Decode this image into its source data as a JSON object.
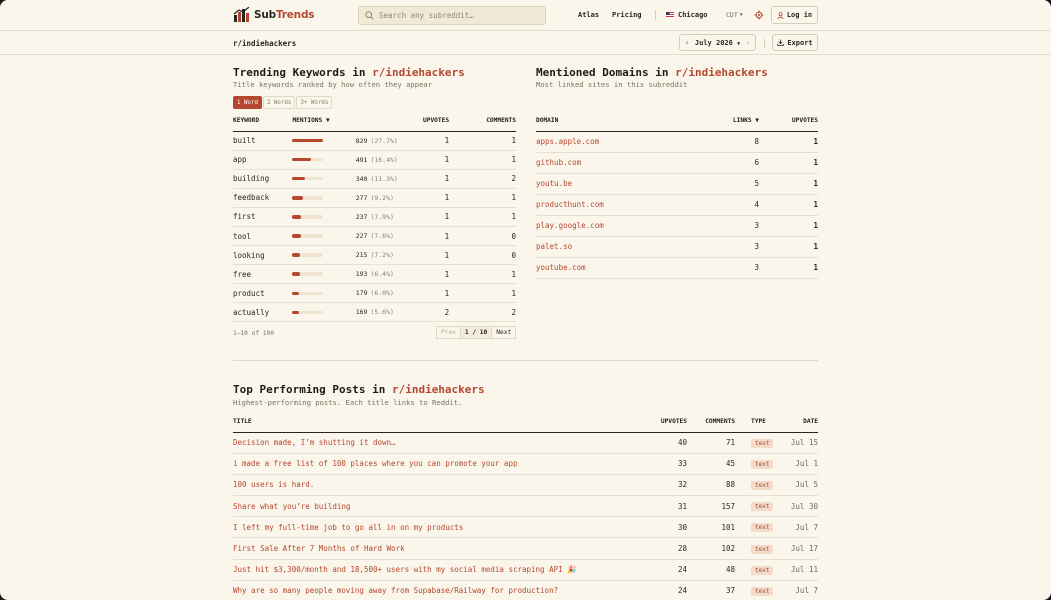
{
  "brand": {
    "part1": "Sub",
    "part2": "Trends"
  },
  "search": {
    "placeholder": "Search any subreddit…"
  },
  "nav": {
    "atlas": "Atlas",
    "pricing": "Pricing",
    "city": "Chicago",
    "tz": "CDT",
    "login": "Log in"
  },
  "subbar": {
    "subreddit": "r/indiehackers",
    "month": "July 2026",
    "export": "Export"
  },
  "keywords": {
    "title_prefix": "Trending Keywords in ",
    "subreddit": "r/indiehackers",
    "description": "Title keywords ranked by how often they appear",
    "tabs": [
      "1 Word",
      "2 Words",
      "3+ Words"
    ],
    "columns": {
      "keyword": "KEYWORD",
      "mentions": "MENTIONS ▼",
      "upvotes": "UPVOTES",
      "comments": "COMMENTS"
    },
    "rows": [
      {
        "keyword": "built",
        "mentions": "829",
        "pct": "(27.7%)",
        "share": 0.277,
        "upvotes": "1",
        "comments": "1"
      },
      {
        "keyword": "app",
        "mentions": "491",
        "pct": "(16.4%)",
        "share": 0.164,
        "upvotes": "1",
        "comments": "1"
      },
      {
        "keyword": "building",
        "mentions": "340",
        "pct": "(11.3%)",
        "share": 0.113,
        "upvotes": "1",
        "comments": "2"
      },
      {
        "keyword": "feedback",
        "mentions": "277",
        "pct": "(9.2%)",
        "share": 0.092,
        "upvotes": "1",
        "comments": "1"
      },
      {
        "keyword": "first",
        "mentions": "237",
        "pct": "(7.9%)",
        "share": 0.079,
        "upvotes": "1",
        "comments": "1"
      },
      {
        "keyword": "tool",
        "mentions": "227",
        "pct": "(7.6%)",
        "share": 0.076,
        "upvotes": "1",
        "comments": "0"
      },
      {
        "keyword": "looking",
        "mentions": "215",
        "pct": "(7.2%)",
        "share": 0.072,
        "upvotes": "1",
        "comments": "0"
      },
      {
        "keyword": "free",
        "mentions": "193",
        "pct": "(6.4%)",
        "share": 0.064,
        "upvotes": "1",
        "comments": "1"
      },
      {
        "keyword": "product",
        "mentions": "179",
        "pct": "(6.0%)",
        "share": 0.06,
        "upvotes": "1",
        "comments": "1"
      },
      {
        "keyword": "actually",
        "mentions": "169",
        "pct": "(5.6%)",
        "share": 0.056,
        "upvotes": "2",
        "comments": "2"
      }
    ],
    "pager": {
      "info": "1–10 of 100",
      "prev": "Prev",
      "page": "1 / 10",
      "next": "Next"
    }
  },
  "domains": {
    "title_prefix": "Mentioned Domains in ",
    "subreddit": "r/indiehackers",
    "description": "Most linked sites in this subreddit",
    "columns": {
      "domain": "DOMAIN",
      "links": "LINKS ▼",
      "upvotes": "UPVOTES"
    },
    "rows": [
      {
        "domain": "apps.apple.com",
        "links": "8",
        "upvotes": "1"
      },
      {
        "domain": "github.com",
        "links": "6",
        "upvotes": "1"
      },
      {
        "domain": "youtu.be",
        "links": "5",
        "upvotes": "1"
      },
      {
        "domain": "producthunt.com",
        "links": "4",
        "upvotes": "1"
      },
      {
        "domain": "play.google.com",
        "links": "3",
        "upvotes": "1"
      },
      {
        "domain": "palet.so",
        "links": "3",
        "upvotes": "1"
      },
      {
        "domain": "youtube.com",
        "links": "3",
        "upvotes": "1"
      }
    ]
  },
  "posts": {
    "title_prefix": "Top Performing Posts in ",
    "subreddit": "r/indiehackers",
    "description": "Highest-performing posts. Each title links to Reddit.",
    "columns": {
      "title": "TITLE",
      "upvotes": "UPVOTES",
      "comments": "COMMENTS",
      "type": "TYPE",
      "date": "DATE"
    },
    "rows": [
      {
        "title": "Decision made, I’m shutting it down…",
        "upvotes": "40",
        "comments": "71",
        "type": "text",
        "date": "Jul 15"
      },
      {
        "title": "i made a free list of 100 places where you can promote your app",
        "upvotes": "33",
        "comments": "45",
        "type": "text",
        "date": "Jul 1"
      },
      {
        "title": "100 users is hard.",
        "upvotes": "32",
        "comments": "88",
        "type": "text",
        "date": "Jul 5"
      },
      {
        "title": "Share what you’re building",
        "upvotes": "31",
        "comments": "157",
        "type": "text",
        "date": "Jul 30"
      },
      {
        "title": "I left my full-time job to go all in on my products",
        "upvotes": "30",
        "comments": "101",
        "type": "text",
        "date": "Jul 7"
      },
      {
        "title": "First Sale After 7 Months of Hard Work",
        "upvotes": "28",
        "comments": "102",
        "type": "text",
        "date": "Jul 17"
      },
      {
        "title": "Just hit $3,300/month and 18,500+ users with my social media scraping API 🎉",
        "upvotes": "24",
        "comments": "48",
        "type": "text",
        "date": "Jul 11"
      },
      {
        "title": "Why are so many people moving away from Supabase/Railway for production?",
        "upvotes": "24",
        "comments": "37",
        "type": "text",
        "date": "Jul 7"
      }
    ]
  },
  "colors": {
    "accent": "#b4472f",
    "background": "#fbf6ec",
    "text": "#2a2520"
  }
}
